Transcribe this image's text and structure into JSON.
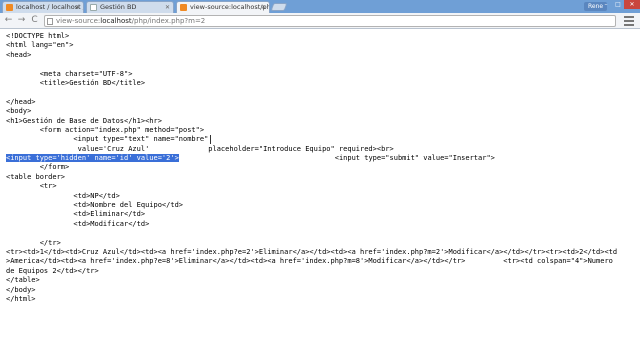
{
  "browser": {
    "tabs": [
      {
        "title": "localhost / localhost / ep",
        "active": false,
        "icon": "phpmyadmin-icon"
      },
      {
        "title": "Gestión BD",
        "active": false,
        "icon": "page-icon"
      },
      {
        "title": "view-source:localhost/php",
        "active": true,
        "icon": "phpmyadmin-icon"
      }
    ],
    "user_badge": "Rene",
    "window_controls": {
      "minimize": "–",
      "maximize": "□",
      "close": "✕"
    },
    "url": {
      "scheme": "view-source:",
      "host": "localhost",
      "path": "/php/index.php?m=2"
    },
    "nav": {
      "back": "←",
      "forward": "→",
      "reload": "C"
    }
  },
  "source_lines": [
    [
      "<!DOCTYPE html>"
    ],
    [
      "<html lang=\"en\">"
    ],
    [
      "<head>"
    ],
    [
      ""
    ],
    [
      "        <meta charset=\"UTF-8\">"
    ],
    [
      "        <title>Gestión BD</title>"
    ],
    [
      ""
    ],
    [
      "</head>"
    ],
    [
      "<body>"
    ],
    [
      "<h1>Gestión de Base de Datos</h1><hr>"
    ],
    [
      "        <form action=\"index.php\" method=\"post\">"
    ],
    [
      "                <input type=\"text\" name=\"nombre\""
    ],
    [
      "                 value='Cruz Azul'              placeholder=\"Introduce Equipo\" required><br>"
    ],
    [
      "<input type='hidden' name='id' value='2'>",
      "                                     <input type=\"submit\" value=\"Insertar\">"
    ],
    [
      "        </form>"
    ],
    [
      "<table border>"
    ],
    [
      "        <tr>"
    ],
    [
      "                <td>NP</td>"
    ],
    [
      "                <td>Nombre del Equipo</td>"
    ],
    [
      "                <td>Eliminar</td>"
    ],
    [
      "                <td>Modificar</td>"
    ],
    [
      ""
    ],
    [
      "        </tr>"
    ],
    [
      "<tr><td>1</td><td>Cruz Azul</td><td><a href='index.php?e=2'>Eliminar</a></td><td><a href='index.php?m=2'>Modificar</a></td></tr><tr><td>2</td><td"
    ],
    [
      ">America</td><td><a href='index.php?e=8'>Eliminar</a></td><td><a href='index.php?m=8'>Modificar</a></td></tr>         <tr><td colspan=\"4\">Numero"
    ],
    [
      "de Equipos 2</td></tr>"
    ],
    [
      "</table>"
    ],
    [
      "</body>"
    ],
    [
      "</html>"
    ]
  ],
  "selected_line_index": 13,
  "colors": {
    "tab_strip": "#6f9fd6",
    "selection": "#3a6fd8",
    "toolbar": "#f2f4f7"
  }
}
